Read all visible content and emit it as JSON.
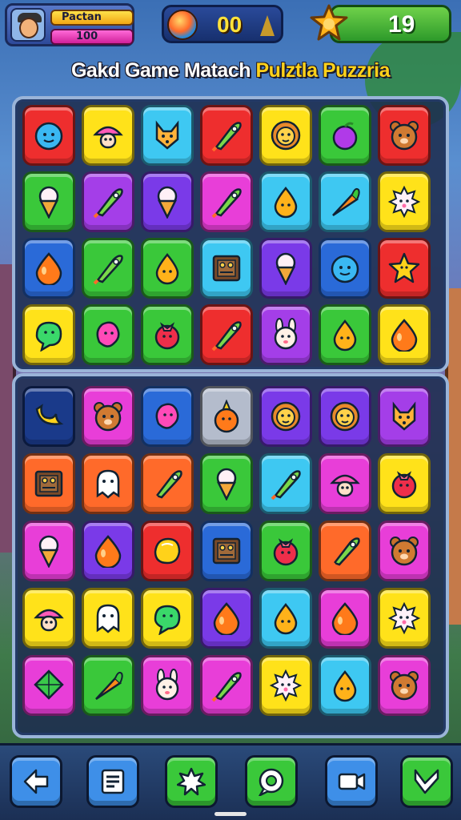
{
  "player": {
    "name": "Pactan",
    "level": "100"
  },
  "coins": {
    "value": "00"
  },
  "score": {
    "value": "19"
  },
  "title": {
    "part1": "Gakd Game Matach",
    "part2": "Pulztla Puzzria"
  },
  "colors": {
    "red": "#ee2e2e",
    "yellow": "#ffe21a",
    "cyan": "#3ec8f2",
    "green": "#3ac83a",
    "purple": "#a43ee8",
    "magenta": "#e83ed8",
    "blue": "#2a6ad8",
    "orange": "#ff6a2a",
    "navy": "#1a3a8a",
    "gray": "#b4bccc",
    "violet": "#7a3ae8"
  },
  "board_top": {
    "rows": [
      [
        {
          "color": "red",
          "icon": "blue-blob-icon"
        },
        {
          "color": "yellow",
          "icon": "mushroom-icon"
        },
        {
          "color": "cyan",
          "icon": "fox-icon"
        },
        {
          "color": "red",
          "icon": "rocket-icon"
        },
        {
          "color": "yellow",
          "icon": "lion-icon"
        },
        {
          "color": "green",
          "icon": "plum-icon"
        },
        {
          "color": "red",
          "icon": "bear-icon"
        }
      ],
      [
        {
          "color": "green",
          "icon": "ice-cream-icon"
        },
        {
          "color": "purple",
          "icon": "rocket-icon"
        },
        {
          "color": "violet",
          "icon": "ice-cream-icon"
        },
        {
          "color": "magenta",
          "icon": "rocket-icon"
        },
        {
          "color": "cyan",
          "icon": "drop-face-icon"
        },
        {
          "color": "cyan",
          "icon": "carrot-icon"
        },
        {
          "color": "yellow",
          "icon": "spiky-face-icon"
        }
      ],
      [
        {
          "color": "blue",
          "icon": "drop-icon"
        },
        {
          "color": "green",
          "icon": "rocket-icon"
        },
        {
          "color": "green",
          "icon": "drop-face-icon"
        },
        {
          "color": "cyan",
          "icon": "crate-icon"
        },
        {
          "color": "violet",
          "icon": "ice-cream-icon"
        },
        {
          "color": "blue",
          "icon": "blue-blob-icon"
        },
        {
          "color": "red",
          "icon": "star-face-icon"
        }
      ],
      [
        {
          "color": "yellow",
          "icon": "green-blob-icon"
        },
        {
          "color": "green",
          "icon": "pink-blob-icon"
        },
        {
          "color": "green",
          "icon": "berry-icon"
        },
        {
          "color": "red",
          "icon": "rocket-icon"
        },
        {
          "color": "purple",
          "icon": "bunny-icon"
        },
        {
          "color": "green",
          "icon": "drop-face-icon"
        },
        {
          "color": "yellow",
          "icon": "drop-icon"
        }
      ]
    ]
  },
  "board_bottom": {
    "rows": [
      [
        {
          "color": "navy",
          "icon": "banana-icon"
        },
        {
          "color": "magenta",
          "icon": "bear-icon"
        },
        {
          "color": "blue",
          "icon": "pink-blob-icon"
        },
        {
          "color": "gray",
          "icon": "orange-face-icon"
        },
        {
          "color": "violet",
          "icon": "lion-icon"
        },
        {
          "color": "violet",
          "icon": "lion-icon"
        },
        {
          "color": "purple",
          "icon": "fox-icon"
        }
      ],
      [
        {
          "color": "orange",
          "icon": "crate-icon"
        },
        {
          "color": "orange",
          "icon": "ghost-icon"
        },
        {
          "color": "orange",
          "icon": "rocket-icon"
        },
        {
          "color": "green",
          "icon": "ice-cream-icon"
        },
        {
          "color": "cyan",
          "icon": "rocket-icon"
        },
        {
          "color": "magenta",
          "icon": "mushroom-icon"
        },
        {
          "color": "yellow",
          "icon": "berry-icon"
        }
      ],
      [
        {
          "color": "magenta",
          "icon": "ice-cream-icon"
        },
        {
          "color": "violet",
          "icon": "drop-icon"
        },
        {
          "color": "red",
          "icon": "lemon-icon"
        },
        {
          "color": "blue",
          "icon": "crate-icon"
        },
        {
          "color": "green",
          "icon": "berry-icon"
        },
        {
          "color": "orange",
          "icon": "rocket-icon"
        },
        {
          "color": "magenta",
          "icon": "bear-icon"
        }
      ],
      [
        {
          "color": "yellow",
          "icon": "mushroom-icon"
        },
        {
          "color": "yellow",
          "icon": "ghost-icon"
        },
        {
          "color": "yellow",
          "icon": "green-blob-icon"
        },
        {
          "color": "violet",
          "icon": "drop-icon"
        },
        {
          "color": "cyan",
          "icon": "drop-face-icon"
        },
        {
          "color": "magenta",
          "icon": "drop-icon"
        },
        {
          "color": "yellow",
          "icon": "spiky-face-icon"
        }
      ],
      [
        {
          "color": "magenta",
          "icon": "kite-icon"
        },
        {
          "color": "green",
          "icon": "carrot-icon"
        },
        {
          "color": "magenta",
          "icon": "bunny-icon"
        },
        {
          "color": "magenta",
          "icon": "rocket-icon"
        },
        {
          "color": "yellow",
          "icon": "spiky-face-icon"
        },
        {
          "color": "cyan",
          "icon": "drop-face-icon"
        },
        {
          "color": "magenta",
          "icon": "bear-icon"
        }
      ]
    ]
  },
  "bottom_buttons": [
    {
      "name": "back-button",
      "icon": "arrow-left-icon",
      "color": "#3e8fe8"
    },
    {
      "name": "menu-button",
      "icon": "list-icon",
      "color": "#3e8fe8"
    },
    {
      "name": "hint-button",
      "icon": "burst-icon",
      "color": "#3ac83a"
    },
    {
      "name": "chat-button",
      "icon": "chat-icon",
      "color": "#3ac83a"
    },
    {
      "name": "video-button",
      "icon": "camera-icon",
      "color": "#3e8fe8"
    },
    {
      "name": "shuffle-button",
      "icon": "check-arrow-icon",
      "color": "#3ac83a"
    }
  ]
}
